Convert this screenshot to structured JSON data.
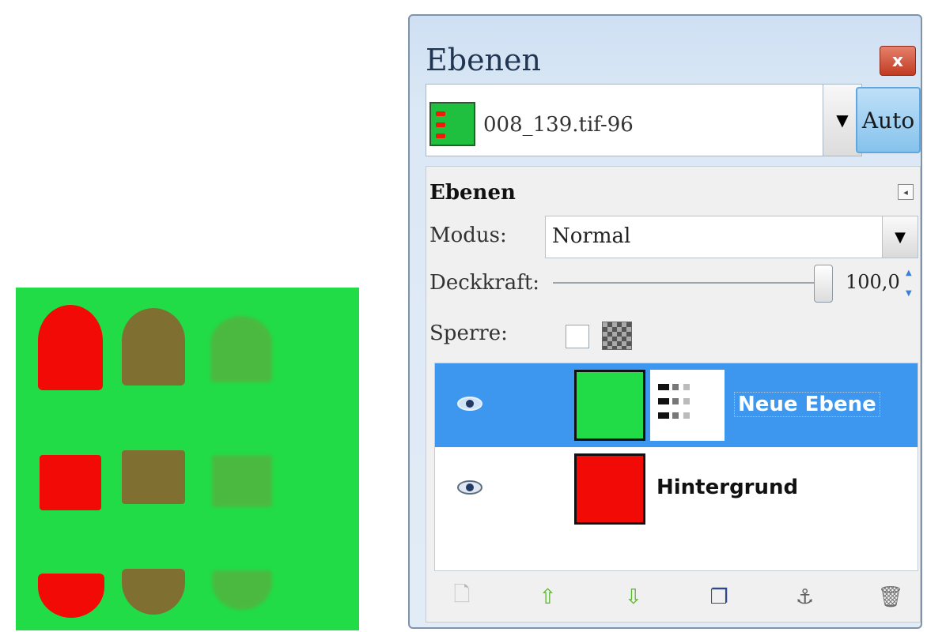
{
  "dialog": {
    "title": "Ebenen",
    "close_label": "x",
    "image_name": "008_139.tif-96",
    "combo_arrow": "▼",
    "auto_label": "Auto"
  },
  "panel": {
    "title": "Ebenen",
    "tab_menu_icon": "◂",
    "mode_label": "Modus:",
    "mode_value": "Normal",
    "mode_arrow": "▼",
    "opacity_label": "Deckkraft:",
    "opacity_value": "100,0",
    "opacity_fraction": 1.0,
    "lock_label": "Sperre:"
  },
  "layers": [
    {
      "name": "Neue Ebene",
      "visible": true,
      "selected": true,
      "thumb_color": "#21dc47"
    },
    {
      "name": "Hintergrund",
      "visible": true,
      "selected": false,
      "thumb_color": "#f20a06"
    }
  ],
  "toolbar": {
    "new_icon": "🗋",
    "raise_icon": "⇧",
    "lower_icon": "⇩",
    "duplicate_icon": "❐",
    "anchor_icon": "⚓",
    "delete_icon": "🗑"
  },
  "colors": {
    "canvas_bg": "#21dc47",
    "shape_red": "#f20a06",
    "shape_brown": "#7f6f31",
    "selection": "#3d97ef"
  }
}
